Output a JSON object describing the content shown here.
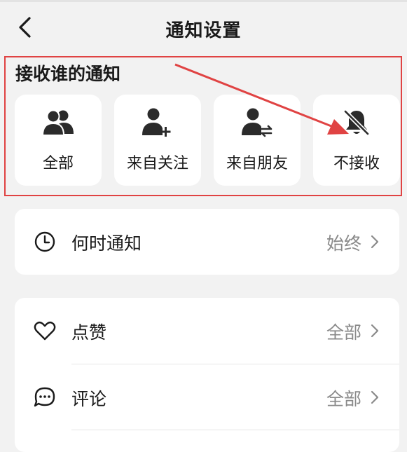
{
  "header": {
    "title": "通知设置"
  },
  "receive": {
    "title": "接收谁的通知",
    "options": [
      {
        "label": "全部",
        "icon": "group-icon"
      },
      {
        "label": "来自关注",
        "icon": "add-person-icon"
      },
      {
        "label": "来自朋友",
        "icon": "friend-exchange-icon"
      },
      {
        "label": "不接收",
        "icon": "bell-off-icon"
      }
    ]
  },
  "when": {
    "label": "何时通知",
    "value": "始终",
    "icon": "clock-icon"
  },
  "items": [
    {
      "label": "点赞",
      "value": "全部",
      "icon": "heart-icon"
    },
    {
      "label": "评论",
      "value": "全部",
      "icon": "comment-icon"
    }
  ],
  "colors": {
    "highlight": "#e04343",
    "background": "#f2f2f2",
    "card": "#ffffff"
  }
}
